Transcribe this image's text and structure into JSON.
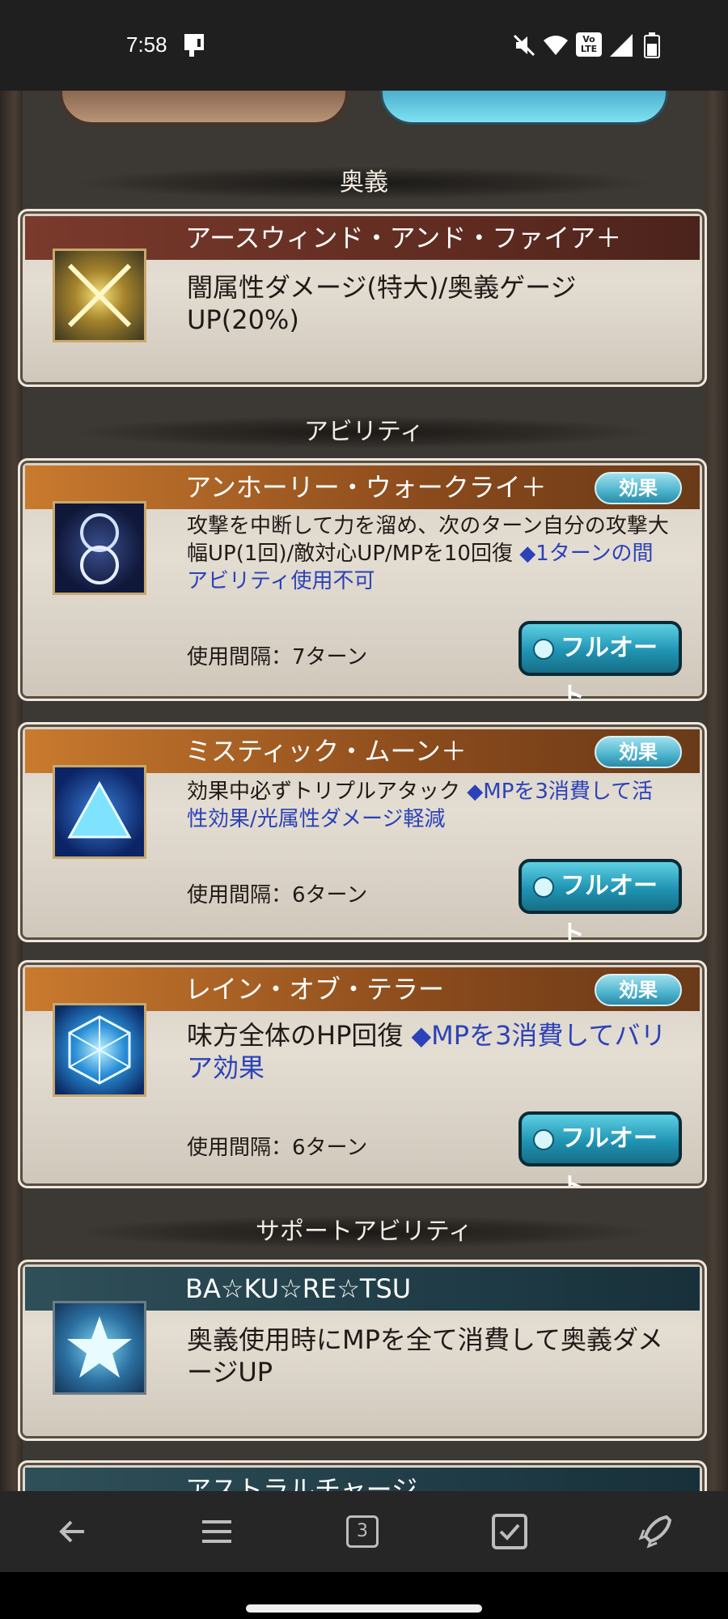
{
  "status_bar": {
    "time": "7:58",
    "icons": [
      "screen-icon",
      "mute-icon",
      "wifi-icon",
      "volte-icon",
      "signal-icon",
      "battery-icon"
    ],
    "volte_label": "Vo\nLTE"
  },
  "sections": {
    "ougi": "奥義",
    "ability": "アビリティ",
    "support": "サポートアビリティ"
  },
  "ougi_card": {
    "title": "アースウィンド・アンド・ファイア＋",
    "desc": "闇属性ダメージ(特大)/奥義ゲージUP(20%)",
    "icon": "crossed-swords-icon"
  },
  "abilities": [
    {
      "title": "アンホーリー・ウォークライ＋",
      "badge": "効果",
      "desc": "攻撃を中断して力を溜め、次のターン自分の攻撃大幅UP(1回)/敵対心UP/MPを10回復",
      "desc_note": "◆1ターンの間アビリティ使用不可",
      "interval": "使用間隔：7ターン",
      "button": "フルオート",
      "icon": "infinity-ring-icon"
    },
    {
      "title": "ミスティック・ムーン＋",
      "badge": "効果",
      "desc": "効果中必ずトリプルアタック",
      "desc_note": "◆MPを3消費して活性効果/光属性ダメージ軽減",
      "interval": "使用間隔：6ターン",
      "button": "フルオート",
      "icon": "triangle-icon"
    },
    {
      "title": "レイン・オブ・テラー",
      "badge": "効果",
      "desc": "味方全体のHP回復",
      "desc_note": "◆MPを3消費してバリア効果",
      "interval": "使用間隔：6ターン",
      "button": "フルオート",
      "icon": "cube-barrier-icon"
    }
  ],
  "support": [
    {
      "title": "BA☆KU☆RE☆TSU",
      "desc": "奥義使用時にMPを全て消費して奥義ダメージUP",
      "icon": "star-icon"
    },
    {
      "title": "アストラルチャージ",
      "icon": "support-icon"
    }
  ],
  "nav": {
    "tab_count": "3",
    "buttons": [
      "back-arrow-icon",
      "menu-icon",
      "tabs-icon",
      "checkbox-icon",
      "rocket-icon"
    ]
  },
  "colors": {
    "accent_blue": "#2b42b8",
    "button_teal": "#1f94b3"
  }
}
